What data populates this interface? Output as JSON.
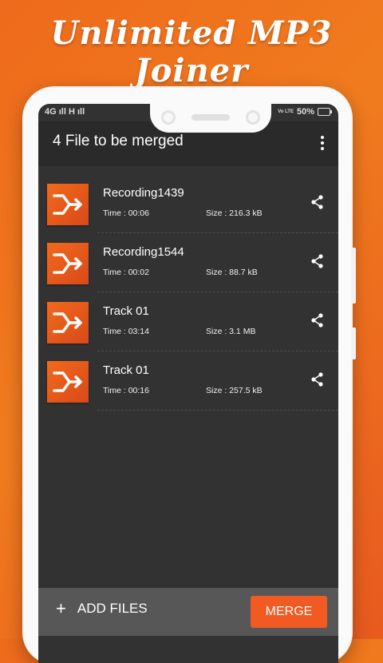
{
  "promo": {
    "title": "Unlimited MP3 Joiner"
  },
  "status": {
    "left": "4G ıll  H ıll",
    "lte": "Vo LTE",
    "battery": "50%"
  },
  "appbar": {
    "title": "4 File to be merged",
    "menu_icon": "more-vert-icon"
  },
  "files": [
    {
      "name": "Recording1439",
      "time": "Time : 00:06",
      "size": "Size : 216.3 kB"
    },
    {
      "name": "Recording1544",
      "time": "Time : 00:02",
      "size": "Size : 88.7 kB"
    },
    {
      "name": "Track 01",
      "time": "Time : 03:14",
      "size": "Size : 3.1 MB"
    },
    {
      "name": "Track 01",
      "time": "Time : 00:16",
      "size": "Size : 257.5 kB"
    }
  ],
  "bottom": {
    "add_label": "ADD FILES",
    "add_icon": "+",
    "merge_label": "MERGE"
  },
  "colors": {
    "accent": "#f15a22",
    "screen_bg": "#323232",
    "appbar_bg": "#2a2a2a",
    "bottom_bg": "#575757"
  }
}
